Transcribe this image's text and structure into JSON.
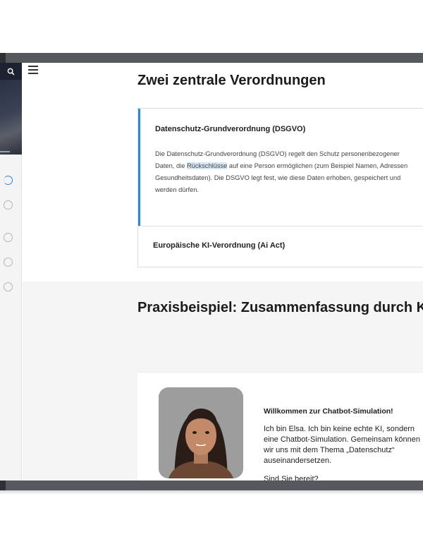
{
  "sidebar": {
    "search_icon": "search-icon",
    "nav_items": [
      {
        "state": "in-progress"
      },
      {
        "state": "not-started"
      },
      {
        "state": "not-started"
      },
      {
        "state": "not-started"
      },
      {
        "state": "not-started"
      }
    ]
  },
  "header": {
    "menu_icon": "hamburger-icon"
  },
  "section1": {
    "title": "Zwei zentrale Verordnungen",
    "accordion": [
      {
        "title": "Datenschutz-Grundverordnung (DSGVO)",
        "expanded": true,
        "body_lines": [
          {
            "before": "Die Datenschutz-Grundverordnung (DSGVO) regelt den Schutz personenbezogener",
            "highlight": "",
            "after": ""
          },
          {
            "before": "Daten, die ",
            "highlight": "Rückschlüsse",
            "after": " auf eine Person ermöglichen (zum Beispiel Namen, Adressen"
          },
          {
            "before": "Gesundheitsdaten). Die DSGVO legt  fest, wie diese Daten erhoben, gespeichert und",
            "highlight": "",
            "after": ""
          },
          {
            "before": "werden dürfen.",
            "highlight": "",
            "after": ""
          }
        ]
      },
      {
        "title": "Europäische KI-Verordnung (Ai Act)",
        "expanded": false
      }
    ]
  },
  "section2": {
    "title": "Praxisbeispiel: Zusammenfassung durch KI",
    "chat": {
      "heading": "Willkommen zur Chatbot-Simulation!",
      "lines": [
        "Ich bin Elsa. Ich bin keine echte KI, sondern",
        "eine Chatbot-Simulation. Gemeinsam können",
        "wir uns mit dem Thema „Datenschutz“",
        "auseinandersetzen."
      ],
      "question": "Sind Sie bereit?"
    }
  },
  "colors": {
    "accent": "#2b8ad6",
    "frame": "#55585c",
    "sidebar_dark": "#1d2230"
  }
}
